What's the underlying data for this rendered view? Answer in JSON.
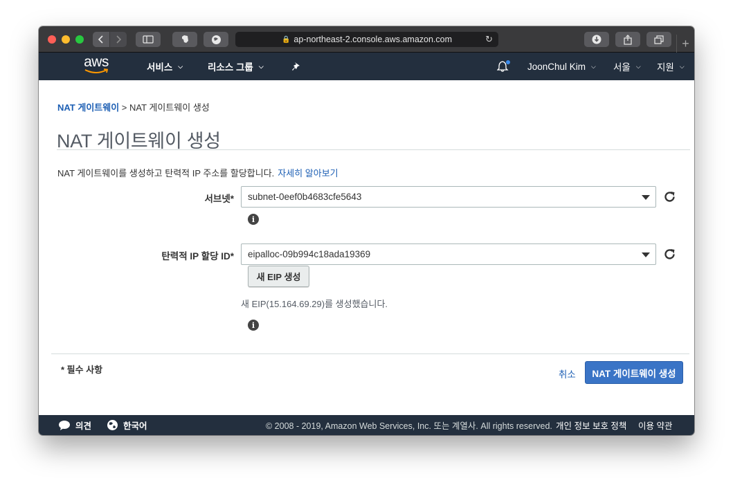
{
  "browser": {
    "url": "ap-northeast-2.console.aws.amazon.com",
    "colors": {
      "close": "#ff5f57",
      "minimize": "#febc2e",
      "maximize": "#28c840"
    }
  },
  "nav": {
    "logo": "aws",
    "services": "서비스",
    "resource_groups": "리소스 그룹",
    "user": "JoonChul Kim",
    "region": "서울",
    "support": "지원"
  },
  "breadcrumb": {
    "parent": "NAT 게이트웨이",
    "separator": " > ",
    "current": "NAT 게이트웨이 생성"
  },
  "page": {
    "title": "NAT 게이트웨이 생성",
    "description": "NAT 게이트웨이를 생성하고 탄력적 IP 주소를 할당합니다.",
    "learn_more": "자세히 알아보기"
  },
  "form": {
    "subnet_label": "서브넷*",
    "subnet_value": "subnet-0eef0b4683cfe5643",
    "eip_label": "탄력적 IP 할당 ID*",
    "eip_value": "eipalloc-09b994c18ada19369",
    "new_eip_button": "새 EIP 생성",
    "eip_message": "새 EIP(15.164.69.29)를 생성했습니다.",
    "required_note": "* 필수 사항",
    "cancel": "취소",
    "submit": "NAT 게이트웨이 생성"
  },
  "footer": {
    "feedback": "의견",
    "language": "한국어",
    "copyright": "© 2008 - 2019, Amazon Web Services, Inc. 또는 계열사. All rights reserved.",
    "privacy": "개인 정보 보호 정책",
    "terms": "이용 약관"
  },
  "colors": {
    "nav_bg": "#232f3e",
    "link": "#1d5fb4",
    "primary_button": "#3a74c6",
    "aws_orange": "#ff9900"
  }
}
